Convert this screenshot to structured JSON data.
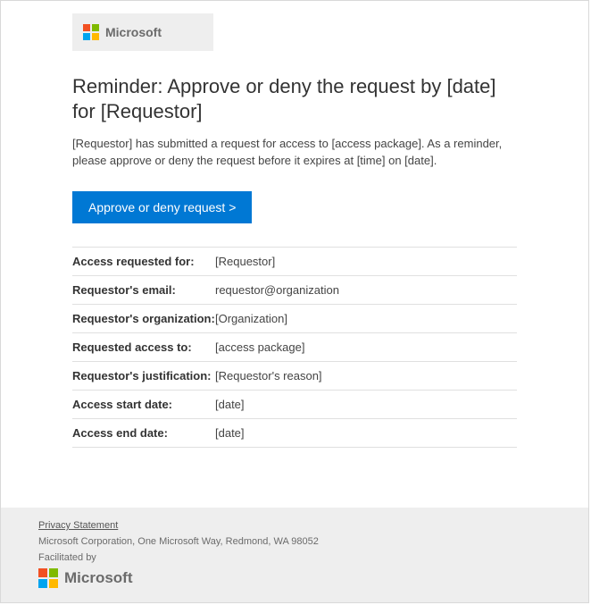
{
  "header": {
    "brand": "Microsoft"
  },
  "title": "Reminder: Approve or deny the request by [date] for [Requestor]",
  "body": "[Requestor] has submitted a request for access to [access package]. As a reminder, please approve or deny the request before it expires at [time] on [date].",
  "cta_label": "Approve or deny request >",
  "details": {
    "access_requested_for": {
      "label": "Access requested for:",
      "value": "[Requestor]"
    },
    "requestor_email": {
      "label": "Requestor's email:",
      "value": "requestor@organization"
    },
    "requestor_org": {
      "label": "Requestor's organization:",
      "value": "[Organization]"
    },
    "requested_access_to": {
      "label": "Requested access to:",
      "value": "[access package]"
    },
    "justification": {
      "label": "Requestor's justification:",
      "value": "[Requestor's reason]"
    },
    "start_date": {
      "label": "Access start date:",
      "value": "[date]"
    },
    "end_date": {
      "label": "Access end date:",
      "value": "[date]"
    }
  },
  "footer": {
    "privacy": "Privacy Statement",
    "address": "Microsoft Corporation, One Microsoft Way, Redmond, WA 98052",
    "facilitated": "Facilitated by",
    "brand": "Microsoft"
  }
}
